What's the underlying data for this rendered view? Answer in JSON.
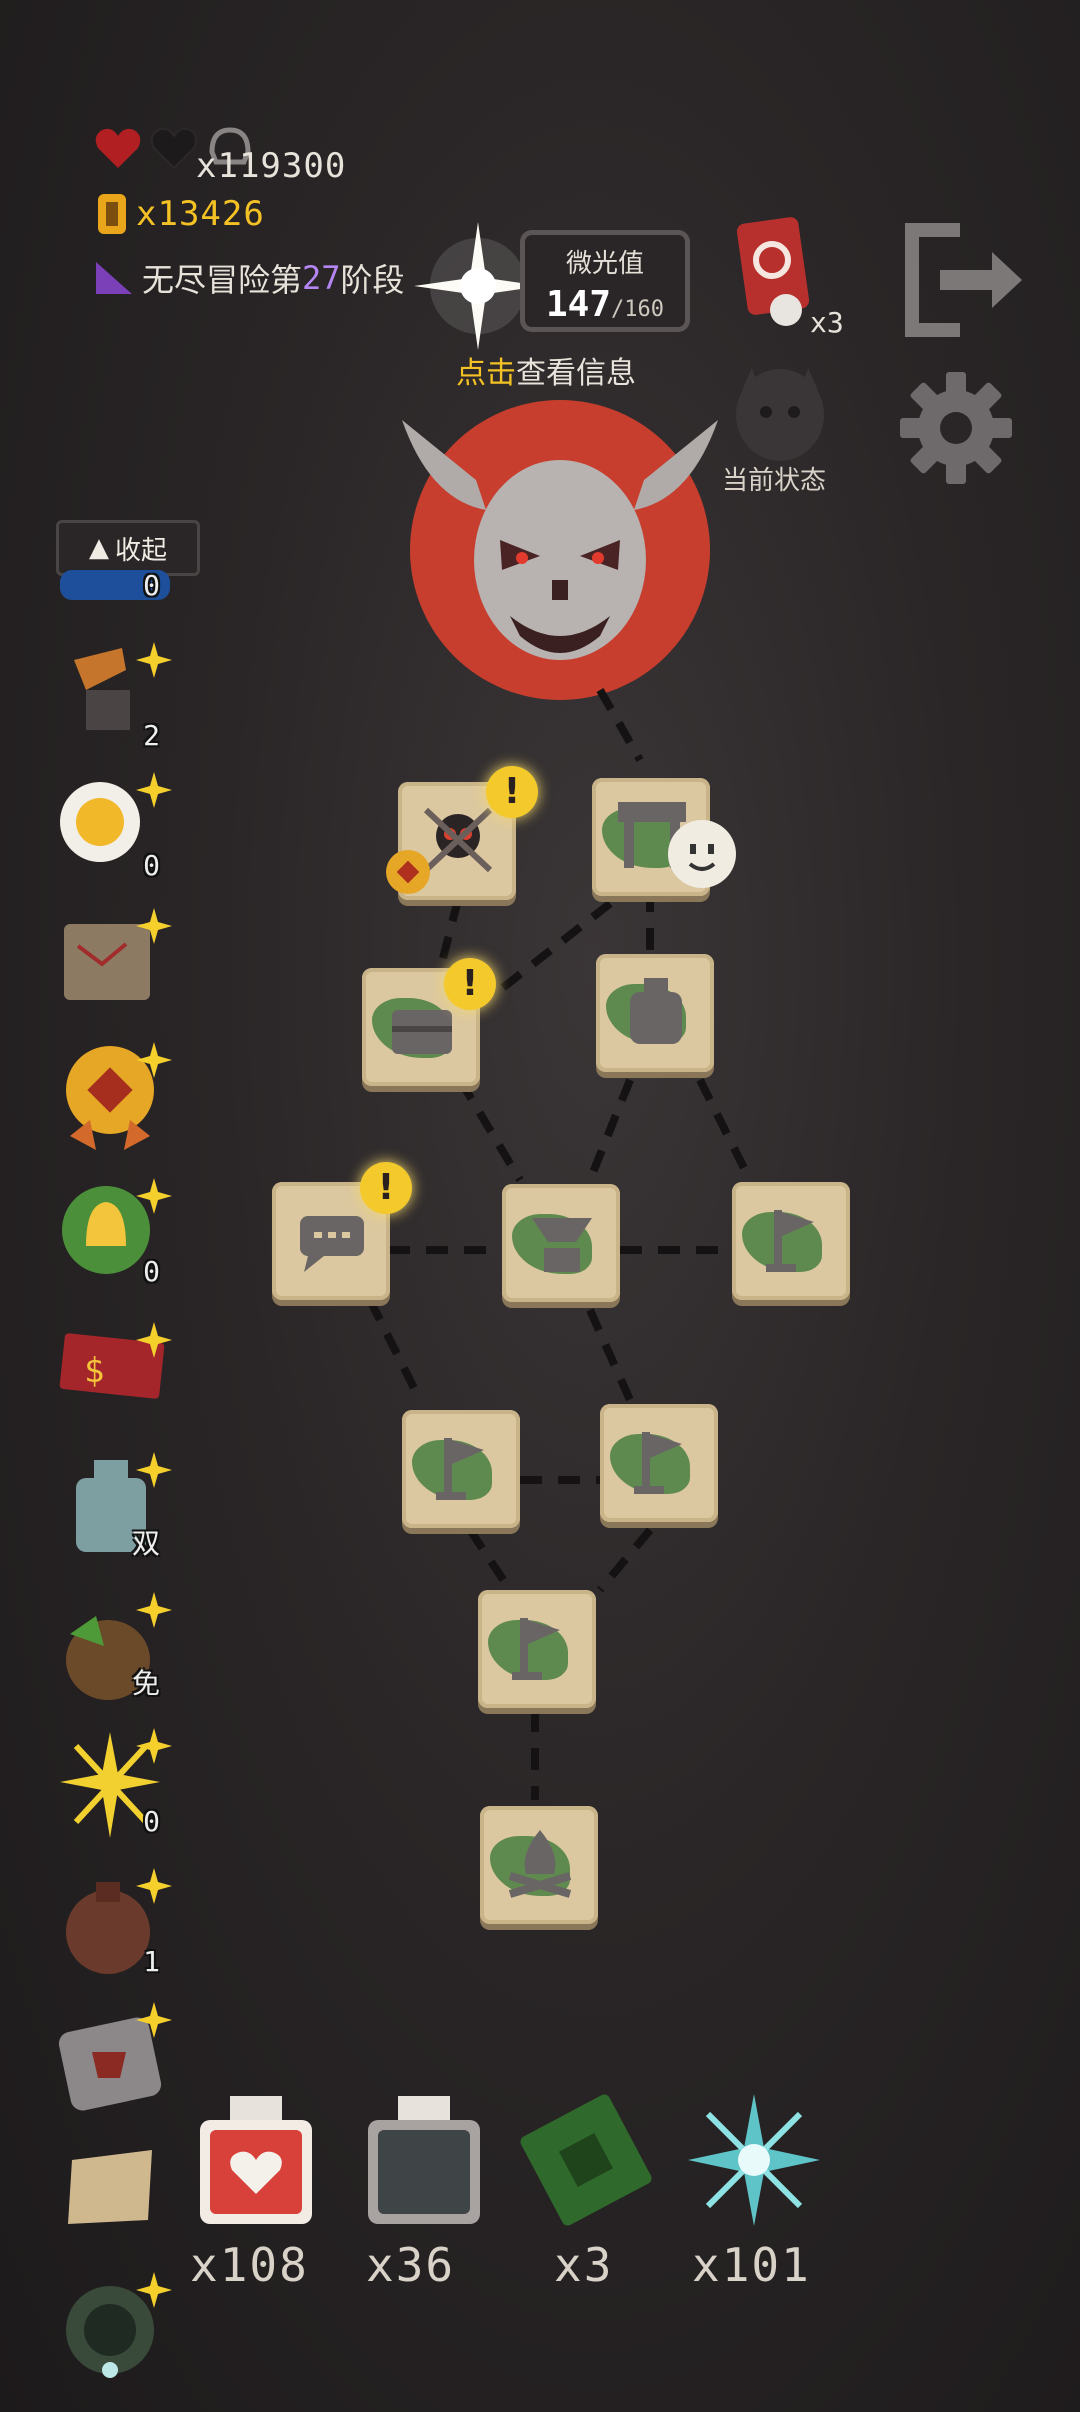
{
  "stats": {
    "hearts_count": "x119300",
    "coins": "x13426",
    "stage_prefix": "无尽冒险第",
    "stage_num": "27",
    "stage_suffix": "阶段"
  },
  "glow": {
    "title": "微光值",
    "current": "147",
    "max": "/160",
    "hint_highlight": "点击",
    "hint_text": "查看信息"
  },
  "card": {
    "count": "x3"
  },
  "status": {
    "label": "当前状态"
  },
  "collapse": {
    "label": "收起"
  },
  "toolbar": [
    {
      "name": "blue-item",
      "count": "0"
    },
    {
      "name": "anvil",
      "count": "2"
    },
    {
      "name": "coin-knife",
      "count": "0"
    },
    {
      "name": "map-scroll",
      "count": ""
    },
    {
      "name": "medal",
      "count": ""
    },
    {
      "name": "bell",
      "count": "0"
    },
    {
      "name": "ticket",
      "count": ""
    },
    {
      "name": "bottle-x2",
      "count": "双"
    },
    {
      "name": "money-bag",
      "count": "免"
    },
    {
      "name": "lightning",
      "count": "0"
    },
    {
      "name": "pouch",
      "count": "1"
    },
    {
      "name": "chip-stone",
      "count": ""
    },
    {
      "name": "parchment",
      "count": ""
    },
    {
      "name": "orb",
      "count": ""
    }
  ],
  "bottom": [
    {
      "name": "red-potion",
      "label": "x108"
    },
    {
      "name": "gray-potion",
      "label": "x36"
    },
    {
      "name": "green-ticket",
      "label": "x3"
    },
    {
      "name": "ice-star",
      "label": "x101"
    }
  ],
  "colors": {
    "accent_yellow": "#f4c224",
    "purple": "#b486f3",
    "boss_red": "#d8402f"
  }
}
